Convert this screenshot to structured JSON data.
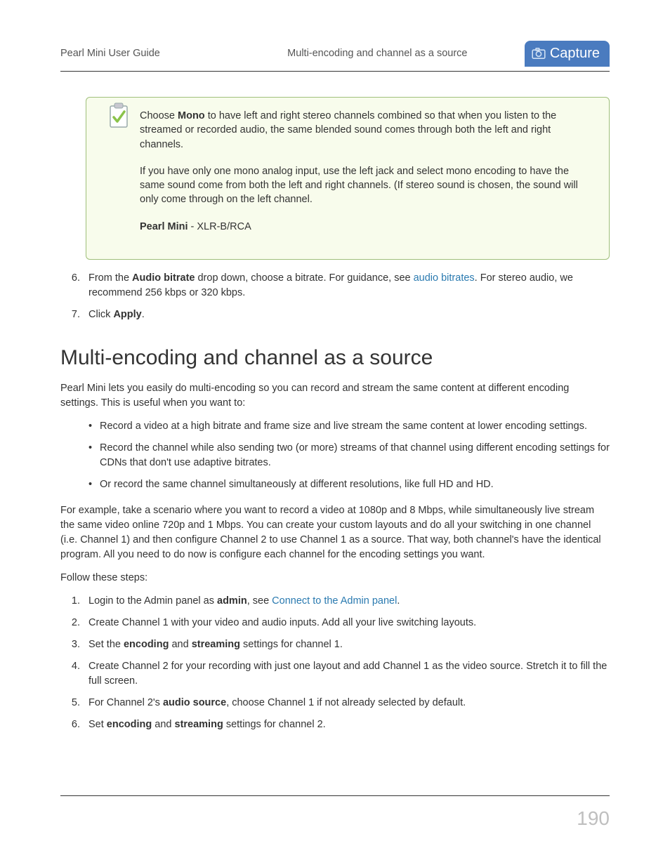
{
  "header": {
    "guide_title": "Pearl Mini User Guide",
    "section_title": "Multi-encoding and channel as a source",
    "badge_label": "Capture"
  },
  "callout": {
    "p1_prefix": "Choose ",
    "p1_bold": "Mono",
    "p1_suffix": " to have left and right stereo channels combined so that when you listen to the streamed or recorded audio, the same blended sound comes through both the left and right channels.",
    "p2": "If you have only one mono analog input, use the left jack and select mono encoding to have the same sound come from both the left and right channels. (If stereo sound is chosen, the sound will only come through on the left channel.",
    "p3_bold": "Pearl Mini",
    "p3_suffix": " - XLR-B/RCA"
  },
  "steps_top": {
    "s6": {
      "num": "6.",
      "t1": "From the ",
      "b1": "Audio bitrate",
      "t2": " drop down, choose a bitrate. For guidance, see ",
      "link": "audio bitrates",
      "t3": ". For stereo audio, we recommend 256 kbps or 320 kbps."
    },
    "s7": {
      "num": "7.",
      "t1": "Click ",
      "b1": "Apply",
      "t2": "."
    }
  },
  "heading": "Multi-encoding and channel as a source",
  "intro": "Pearl Mini lets you easily do multi-encoding so you can record and stream the same content at different encoding settings. This is useful when you want to:",
  "bullets": {
    "b1": "Record a video at a high bitrate and frame size and live stream the same content at lower encoding settings.",
    "b2": "Record the channel while also sending two (or more) streams of that channel using different encoding settings for CDNs that don't use adaptive bitrates.",
    "b3": "Or record the same channel simultaneously at different resolutions, like full HD and HD."
  },
  "example": "For example, take a scenario where you want to record a video at 1080p and 8 Mbps, while simultaneously live stream the same video online 720p and 1 Mbps. You can create your custom layouts and do all your switching in one channel (i.e. Channel 1) and then configure Channel 2 to use Channel 1 as a source. That way, both channel's have the identical program. All you need to do now is configure each channel for the encoding settings you want.",
  "follow": "Follow these steps:",
  "steps_main": {
    "s1": {
      "num": "1.",
      "t1": "Login to the Admin panel as ",
      "b1": "admin",
      "t2": ", see ",
      "link": "Connect to the Admin panel",
      "t3": "."
    },
    "s2": {
      "num": "2.",
      "text": "Create Channel 1 with your video and audio inputs. Add all your live switching layouts."
    },
    "s3": {
      "num": "3.",
      "t1": "Set the ",
      "b1": "encoding",
      "t2": " and ",
      "b2": "streaming",
      "t3": " settings for channel 1."
    },
    "s4": {
      "num": "4.",
      "text": "Create Channel 2 for your recording with just one layout and add Channel 1 as the video source. Stretch it to fill the full screen."
    },
    "s5": {
      "num": "5.",
      "t1": "For Channel 2's ",
      "b1": "audio source",
      "t2": ", choose Channel 1 if not already selected by default."
    },
    "s6": {
      "num": "6.",
      "t1": "Set ",
      "b1": "encoding",
      "t2": " and ",
      "b2": "streaming",
      "t3": " settings for channel 2."
    }
  },
  "page_number": "190"
}
